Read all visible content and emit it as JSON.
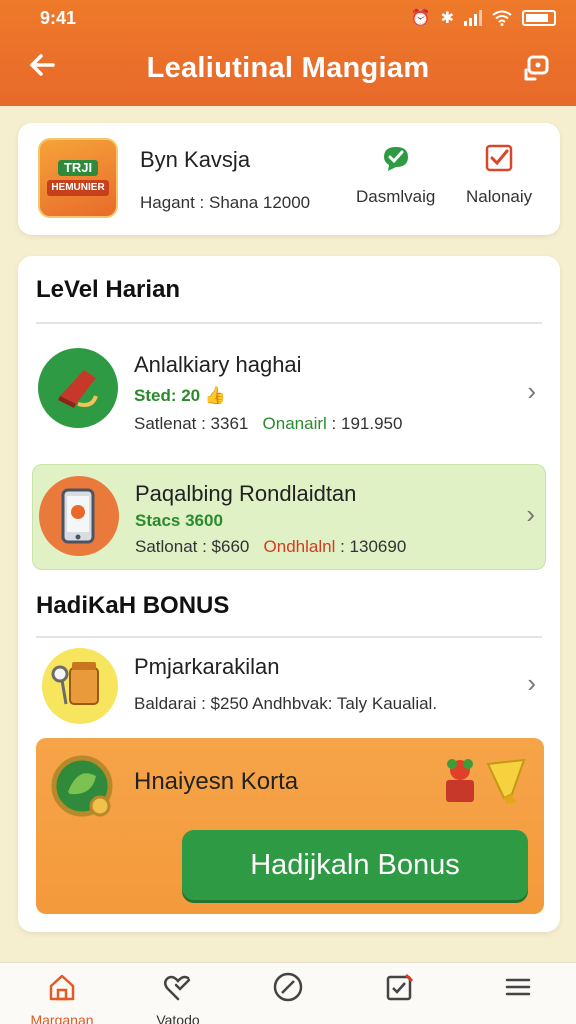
{
  "status_bar": {
    "time": "9:41"
  },
  "header": {
    "title": "Lealiutinal Mangiam"
  },
  "profile": {
    "logo_line1": "TRJI",
    "logo_line2": "HEMUNIER",
    "name": "Byn Kavsja",
    "balance": "Hagant : Shana 12000",
    "actions": [
      {
        "label": "Dasmlvaig",
        "icon": "chat-check-icon"
      },
      {
        "label": "Nalonaiy",
        "icon": "checkbox-icon"
      }
    ]
  },
  "level_section": {
    "title": "LeVel Harian",
    "items": [
      {
        "name": "Anlalkiary haghai",
        "stat": "Sted: 20",
        "meta_left": "Satlenat : 3361",
        "meta_right_label": "Onanairl",
        "meta_right_value": ": 191.950"
      },
      {
        "name": "Paqalbing Rondlaidtan",
        "stat": "Stacs 3600",
        "meta_left": "Satlonat : $660",
        "meta_right_label": "Ondhlalnl",
        "meta_right_value": ": 130690"
      }
    ]
  },
  "bonus_section": {
    "title": "HadiKaH BONUS",
    "item": {
      "name": "Pmjarkarakilan",
      "meta": "Baldarai : $250  Andhbvak: Taly Kaualial."
    },
    "card_title": "Hnaiyesn Korta",
    "button_label": "Hadijkaln Bonus"
  },
  "bottom_nav": [
    {
      "label": "Marganan",
      "icon": "home-icon",
      "active": true
    },
    {
      "label": "Vatodo",
      "icon": "heart-check-icon",
      "active": false
    },
    {
      "label": "",
      "icon": "block-icon",
      "active": false
    },
    {
      "label": "",
      "icon": "edit-check-icon",
      "active": false
    },
    {
      "label": "",
      "icon": "menu-icon",
      "active": false
    }
  ],
  "colors": {
    "header": "#e8692a",
    "accent_green": "#2f9a44",
    "highlight_row": "#e0f1c6",
    "bonus_card": "#f39a3b",
    "background": "#f6efcf"
  }
}
